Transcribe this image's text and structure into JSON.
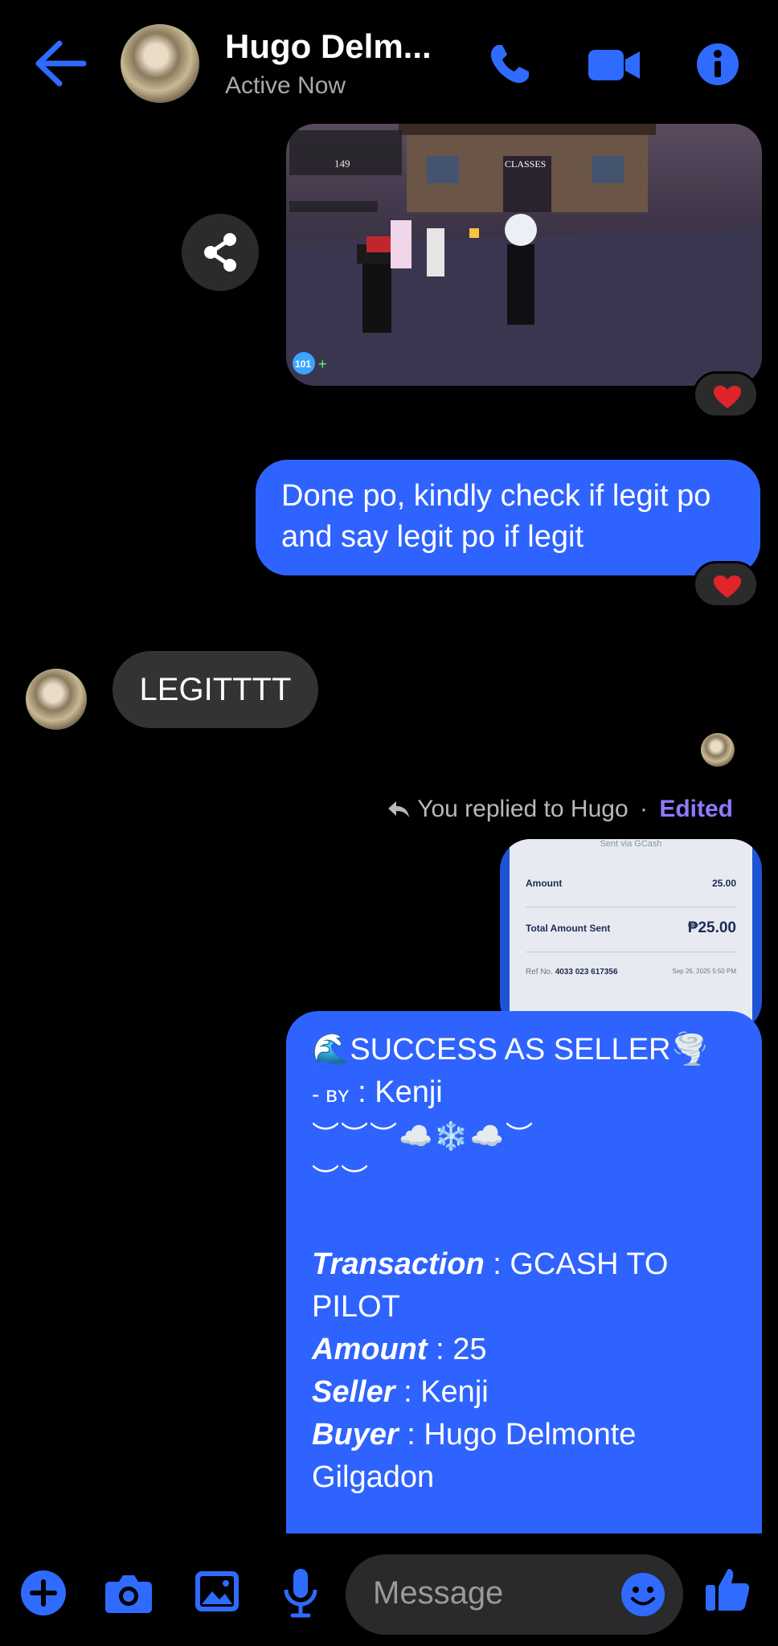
{
  "header": {
    "contact_name": "Hugo Delm...",
    "status": "Active Now"
  },
  "colors": {
    "accent": "#2f63ff",
    "icon": "#2f6bff",
    "incoming_bubble": "#333335",
    "edited": "#8c7bff",
    "reaction": "#e0242c"
  },
  "icons": [
    "back-arrow-icon",
    "phone-icon",
    "video-icon",
    "info-icon",
    "share-icon",
    "heart-icon",
    "reply-icon",
    "plus-icon",
    "camera-icon",
    "image-icon",
    "microphone-icon",
    "emoji-icon",
    "thumbs-up-icon"
  ],
  "messages": {
    "screenshot": {
      "hud_top": "CLASSES",
      "hud_counter": "149",
      "hud_badge": "101"
    },
    "outgoing_text": "Done po, kindly check if legit po and say legit po if legit",
    "incoming_text": "LEGITTTT",
    "reply_context": {
      "text": "You replied to Hugo",
      "separator": "·",
      "edited": "Edited"
    },
    "receipt": {
      "caption": "Sent via GCash",
      "amount_label": "Amount",
      "amount_value": "25.00",
      "total_label": "Total Amount Sent",
      "total_value": "₱25.00",
      "ref_label": "Ref No.",
      "ref_value": "4033 023 617356",
      "date": "Sep 26, 2025 5:50 PM"
    },
    "seller_message": {
      "title": "🌊SUCCESS AS SELLER🌪️",
      "by_prefix": "- ʙʏ",
      "by_sep": " : ",
      "by_name": "Kenji",
      "deco_1": "︶︶︶☁️❄️☁️︶",
      "deco_2": "︶︶",
      "transaction_label": "Transaction",
      "transaction_value": " : GCASH TO",
      "transaction_value_2": "PILOT",
      "amount_label": "Amount",
      "amount_value": " : 25",
      "seller_label": "Seller",
      "seller_value": " : Kenji",
      "buyer_label": "Buyer",
      "buyer_value": " : Hugo Delmonte",
      "buyer_value_2": "Gilgadon"
    }
  },
  "composer": {
    "placeholder": "Message"
  }
}
